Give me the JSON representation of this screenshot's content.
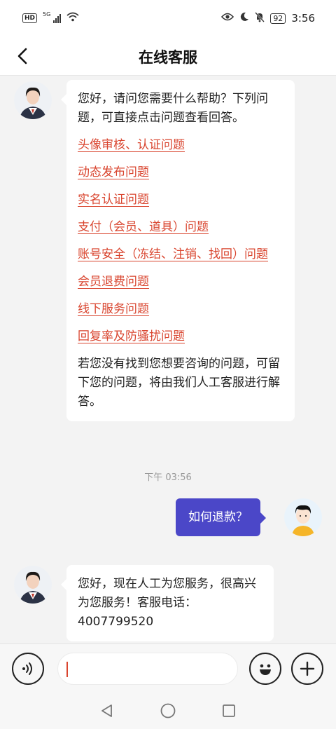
{
  "status_bar": {
    "hd": "HD",
    "network": "5G",
    "battery": "92",
    "time": "3:56"
  },
  "header": {
    "title": "在线客服"
  },
  "messages": {
    "welcome": {
      "intro": "您好，请问您需要什么帮助？下列问题，可直接点击问题查看回答。",
      "links": [
        "头像审核、认证问题",
        "动态发布问题",
        "实名认证问题",
        "支付（会员、道具）问题",
        "账号安全（冻结、注销、找回）问题",
        "会员退费问题",
        "线下服务问题",
        "回复率及防骚扰问题"
      ],
      "outro": "若您没有找到您想要咨询的问题，可留下您的问题，将由我们人工客服进行解答。"
    },
    "timestamp": "下午 03:56",
    "user_message": "如何退款？",
    "reply": "您好，现在人工为您服务，很高兴为您服务！客服电话：4007799520"
  },
  "input": {
    "value": "",
    "placeholder": ""
  },
  "icons": {
    "back": "back-arrow-icon",
    "voice": "voice-icon",
    "emoji": "emoji-icon",
    "plus": "plus-icon",
    "nav_back": "triangle-back-icon",
    "nav_home": "circle-home-icon",
    "nav_recent": "square-recent-icon"
  },
  "colors": {
    "link": "#d9452f",
    "user_bubble": "#4b47c8",
    "background": "#f3f3f3"
  }
}
